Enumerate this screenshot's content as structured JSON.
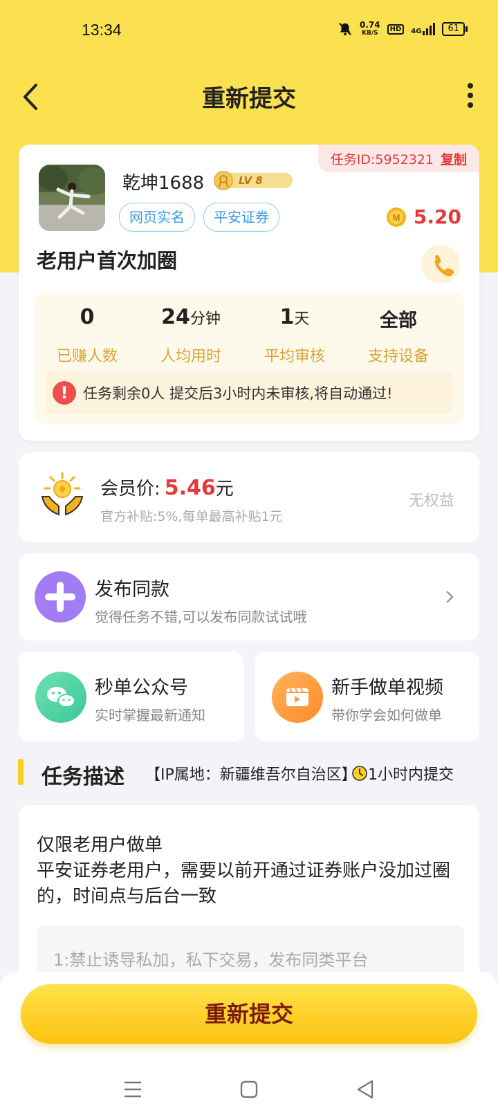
{
  "status_bar": {
    "time": "13:34",
    "net_speed_value": "0.74",
    "net_speed_unit": "KB/S",
    "hd": "HD",
    "signal": "4G",
    "battery": "61"
  },
  "nav": {
    "title": "重新提交"
  },
  "task": {
    "id_label": "任务ID:5952321",
    "copy_label": "复制",
    "username": "乾坤1688",
    "level": "LV 8",
    "tags": [
      "网页实名",
      "平安证券"
    ],
    "reward": "5.20",
    "name": "老用户首次加圈",
    "stats": [
      {
        "value": "0",
        "unit": "",
        "label": "已赚人数"
      },
      {
        "value": "24",
        "unit": "分钟",
        "label": "人均用时"
      },
      {
        "value": "1",
        "unit": "天",
        "label": "平均审核"
      },
      {
        "value": "全部",
        "unit": "",
        "label": "支持设备"
      }
    ],
    "notice": "任务剩余0人  提交后3小时内未审核,将自动通过!"
  },
  "member": {
    "label": "会员价:",
    "price": "5.46",
    "unit": "元",
    "subsidy": "官方补贴:5%,每单最高补贴1元",
    "rights": "无权益"
  },
  "publish": {
    "title": "发布同款",
    "subtitle": "觉得任务不错,可以发布同款试试哦"
  },
  "wechat": {
    "title": "秒单公众号",
    "subtitle": "实时掌握最新通知"
  },
  "video": {
    "title": "新手做单视频",
    "subtitle": "带你学会如何做单"
  },
  "section": {
    "title": "任务描述",
    "ip": "【IP属地：新疆维吾尔自治区】",
    "time_limit": "1小时内提交"
  },
  "description": {
    "line1": "仅限老用户做单",
    "line2": "平安证券老用户，需要以前开通过证券账户没加过圈的，时间点与后台一致",
    "rule": "1:禁止诱导私加，私下交易，发布同类平台"
  },
  "bottom": {
    "submit_label": "重新提交"
  },
  "colors": {
    "brand_yellow": "#fbe04f",
    "price_red": "#e23a3a",
    "tag_blue": "#3a9ae0"
  }
}
